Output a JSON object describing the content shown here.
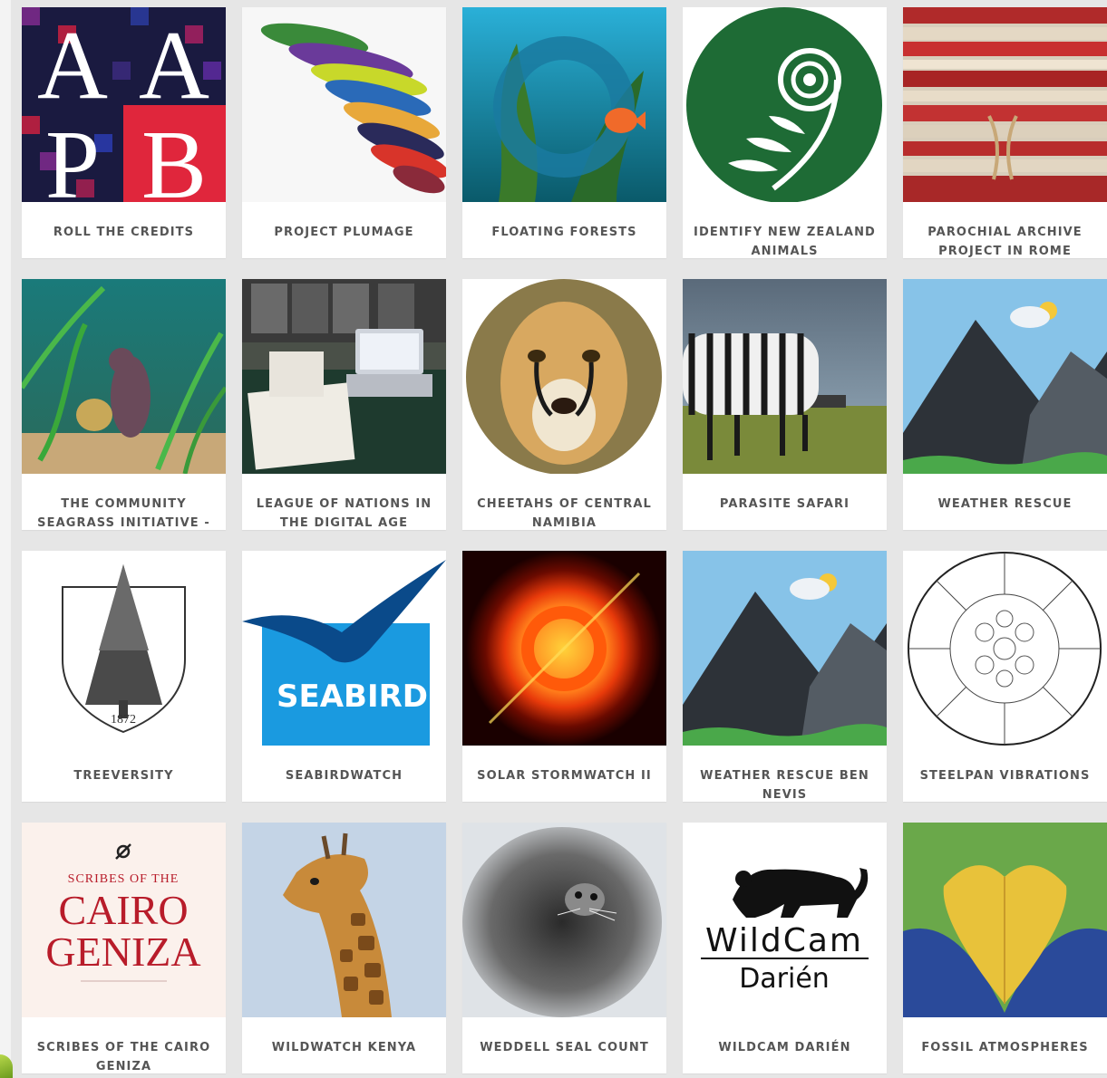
{
  "projects": [
    {
      "title": "ROLL THE CREDITS"
    },
    {
      "title": "PROJECT PLUMAGE"
    },
    {
      "title": "FLOATING FORESTS"
    },
    {
      "title": "IDENTIFY NEW ZEALAND ANIMALS"
    },
    {
      "title": "PAROCHIAL ARCHIVE PROJECT IN ROME"
    },
    {
      "title": "THE COMMUNITY SEAGRASS INITIATIVE -"
    },
    {
      "title": "LEAGUE OF NATIONS IN THE DIGITAL AGE"
    },
    {
      "title": "CHEETAHS OF CENTRAL NAMIBIA"
    },
    {
      "title": "PARASITE SAFARI"
    },
    {
      "title": "WEATHER RESCUE"
    },
    {
      "title": "TREEVERSITY",
      "image_text": "1872"
    },
    {
      "title": "SEABIRDWATCH",
      "image_text": "SEABIRD WATCH"
    },
    {
      "title": "SOLAR STORMWATCH II"
    },
    {
      "title": "WEATHER RESCUE BEN NEVIS"
    },
    {
      "title": "STEELPAN VIBRATIONS"
    },
    {
      "title": "SCRIBES OF THE CAIRO GENIZA",
      "image_text": [
        "SCRIBES OF THE",
        "CAIRO",
        "GENIZA"
      ]
    },
    {
      "title": "WILDWATCH KENYA"
    },
    {
      "title": "WEDDELL SEAL COUNT"
    },
    {
      "title": "WILDCAM DARIÉN",
      "image_text": [
        "WildCam",
        "Darién"
      ]
    },
    {
      "title": "FOSSIL ATMOSPHERES"
    }
  ],
  "logo_text": {
    "aapb": [
      "A",
      "A",
      "P",
      "B"
    ]
  },
  "colors": {
    "page_bg": "#e6e6e6",
    "card_bg": "#ffffff",
    "title_text": "#555555"
  }
}
